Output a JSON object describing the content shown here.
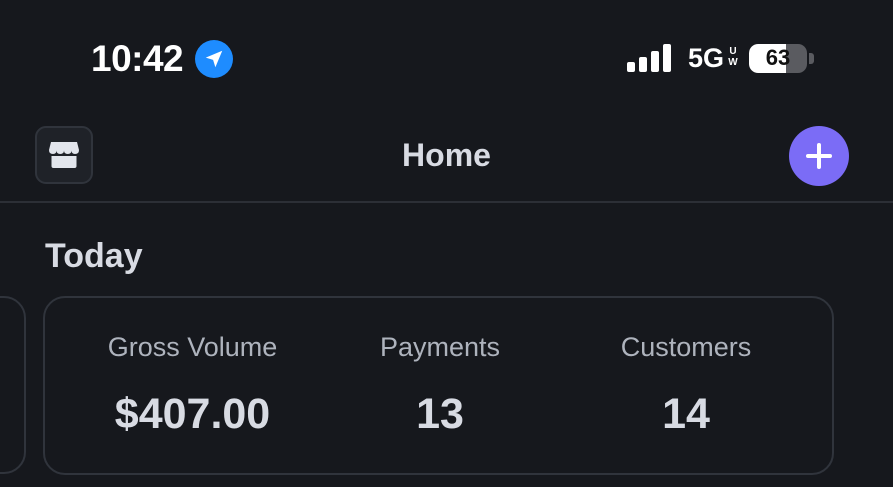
{
  "status_bar": {
    "time": "10:42",
    "location_icon": "location-arrow-icon",
    "signal_bars": 4,
    "network": "5G",
    "network_sub_top": "U",
    "network_sub_bottom": "W",
    "battery_level": "63",
    "battery_percent": 63
  },
  "nav": {
    "left_icon": "store-icon",
    "title": "Home",
    "right_icon": "plus-icon"
  },
  "colors": {
    "background": "#16181d",
    "accent": "#7b6cf6",
    "location_blue": "#1e8cff",
    "card_border": "#30343c"
  },
  "today": {
    "title": "Today",
    "stats": [
      {
        "label": "Gross Volume",
        "value": "$407.00"
      },
      {
        "label": "Payments",
        "value": "13"
      },
      {
        "label": "Customers",
        "value": "14"
      }
    ]
  }
}
